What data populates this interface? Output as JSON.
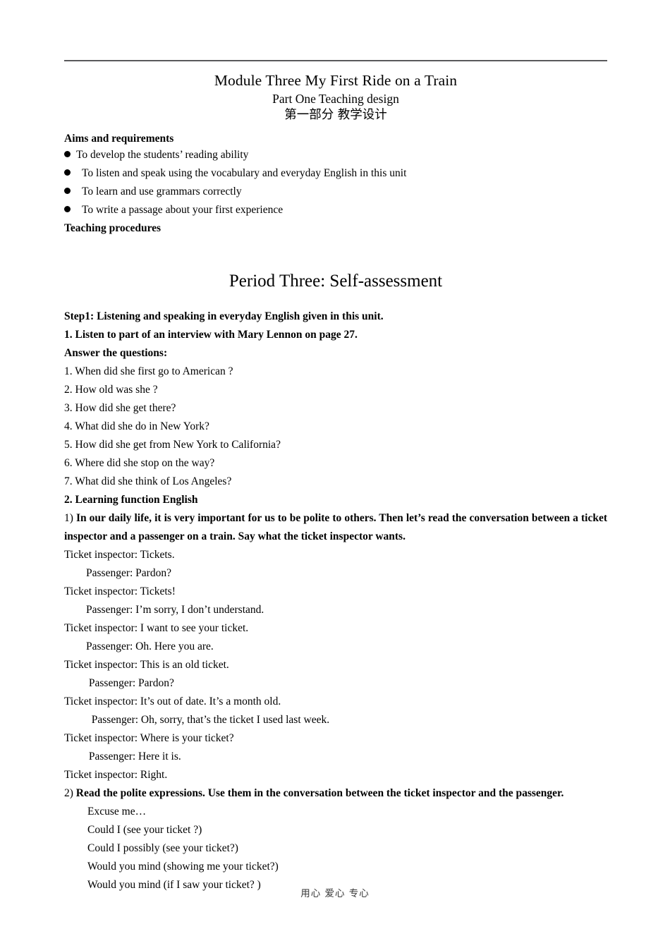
{
  "document": {
    "title": "Module Three  My First Ride on a Train",
    "subtitle_en": "Part One  Teaching design",
    "subtitle_cn": "第一部分 教学设计",
    "footer": "用心  爱心  专心"
  },
  "aims": {
    "heading": "Aims and requirements",
    "items": [
      "To develop the students’ reading ability",
      "To listen and speak using the vocabulary and everyday English in this unit",
      "To learn and use grammars correctly",
      "To write a passage about your first experience"
    ]
  },
  "teaching_procedures_heading": "Teaching procedures",
  "period": {
    "heading": "Period Three: Self-assessment"
  },
  "step1": {
    "heading": "Step1: Listening and speaking in everyday English given in this unit.",
    "task1": "1. Listen to part of an interview with Mary Lennon on page 27.",
    "answer_heading": "Answer the questions:",
    "questions": [
      "1. When did she first go to American ?",
      "2. How old was she ?",
      "3. How did she get there?",
      "4. What did she do in New York?",
      "5. How did she get from New York to California?",
      "6. Where did she stop on the way?",
      "7. What did she think of Los Angeles?"
    ]
  },
  "section2": {
    "heading": "2. Learning function English",
    "item1_number": "1) ",
    "item1_text": "In our daily life, it is very important for us to be polite to others. Then let’s read the conversation between a ticket inspector and a passenger on a train. Say what the ticket inspector wants.",
    "dialogue": [
      "Ticket inspector: Tickets.",
      "        Passenger: Pardon?",
      "Ticket inspector: Tickets!",
      "        Passenger: I’m sorry, I don’t understand.",
      "Ticket inspector: I want to see your ticket.",
      "        Passenger: Oh. Here you are.",
      "Ticket inspector: This is an old ticket.",
      "         Passenger: Pardon?",
      "Ticket inspector: It’s out of date. It’s a month old.",
      "          Passenger: Oh, sorry, that’s the ticket I used last week.",
      "Ticket inspector: Where is your ticket?",
      "         Passenger: Here it is.",
      "Ticket inspector: Right."
    ],
    "item2_number": "2) ",
    "item2_text": "Read the polite expressions. Use them in the conversation between the ticket inspector and the passenger.",
    "expressions": [
      "Excuse me…",
      "Could I (see your ticket ?)",
      "Could I possibly (see your ticket?)",
      "Would you mind (showing me your ticket?)",
      "Would you mind (if I saw your ticket? )"
    ]
  }
}
